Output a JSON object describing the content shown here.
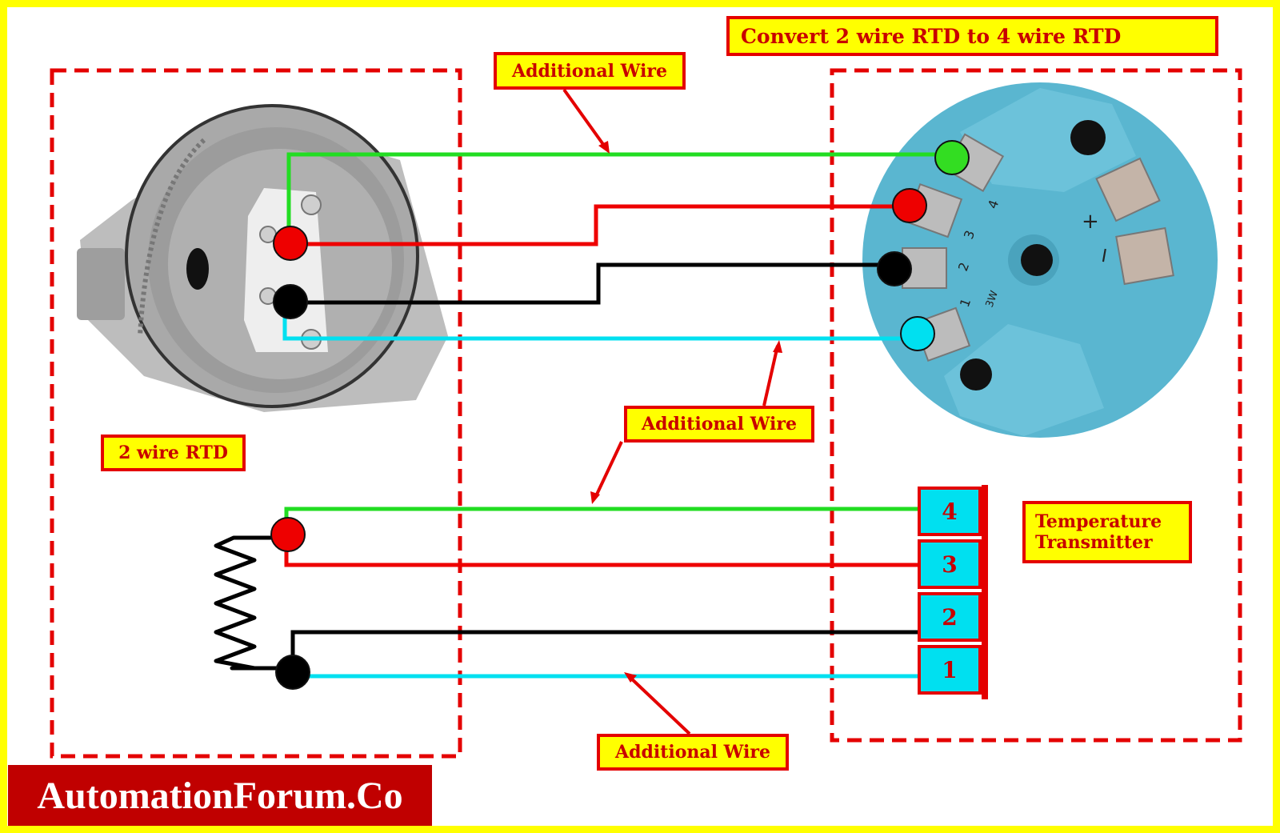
{
  "title": "Convert 2 wire RTD to 4 wire RTD",
  "labels": {
    "additional_wire_top": "Additional Wire",
    "additional_wire_middle": "Additional Wire",
    "additional_wire_bottom": "Additional Wire",
    "rtd_2wire": "2 wire RTD",
    "transmitter_line1": "Temperature",
    "transmitter_line2": "Transmitter"
  },
  "terminals": [
    {
      "number": "4",
      "wire_color": "green"
    },
    {
      "number": "3",
      "wire_color": "red"
    },
    {
      "number": "2",
      "wire_color": "black"
    },
    {
      "number": "1",
      "wire_color": "cyan"
    }
  ],
  "transmitter_markings": {
    "terminal_numbers": [
      "1",
      "2",
      "3",
      "4"
    ],
    "mode_label": "3W",
    "plus": "+",
    "minus": "−"
  },
  "wire_colors": {
    "green": "#22dd22",
    "red": "#ee0000",
    "black": "#000000",
    "cyan": "#00e0f0"
  },
  "colors": {
    "frame": "#ffff00",
    "label_fill": "#ffff00",
    "label_border": "#e40000",
    "label_text": "#c80000",
    "dashed_border": "#e40000",
    "logo_bg": "#c00000",
    "transmitter_body": "#5ab6d0",
    "rtd_head": "#a8a8a8"
  },
  "logo": "AutomationForum.Co"
}
